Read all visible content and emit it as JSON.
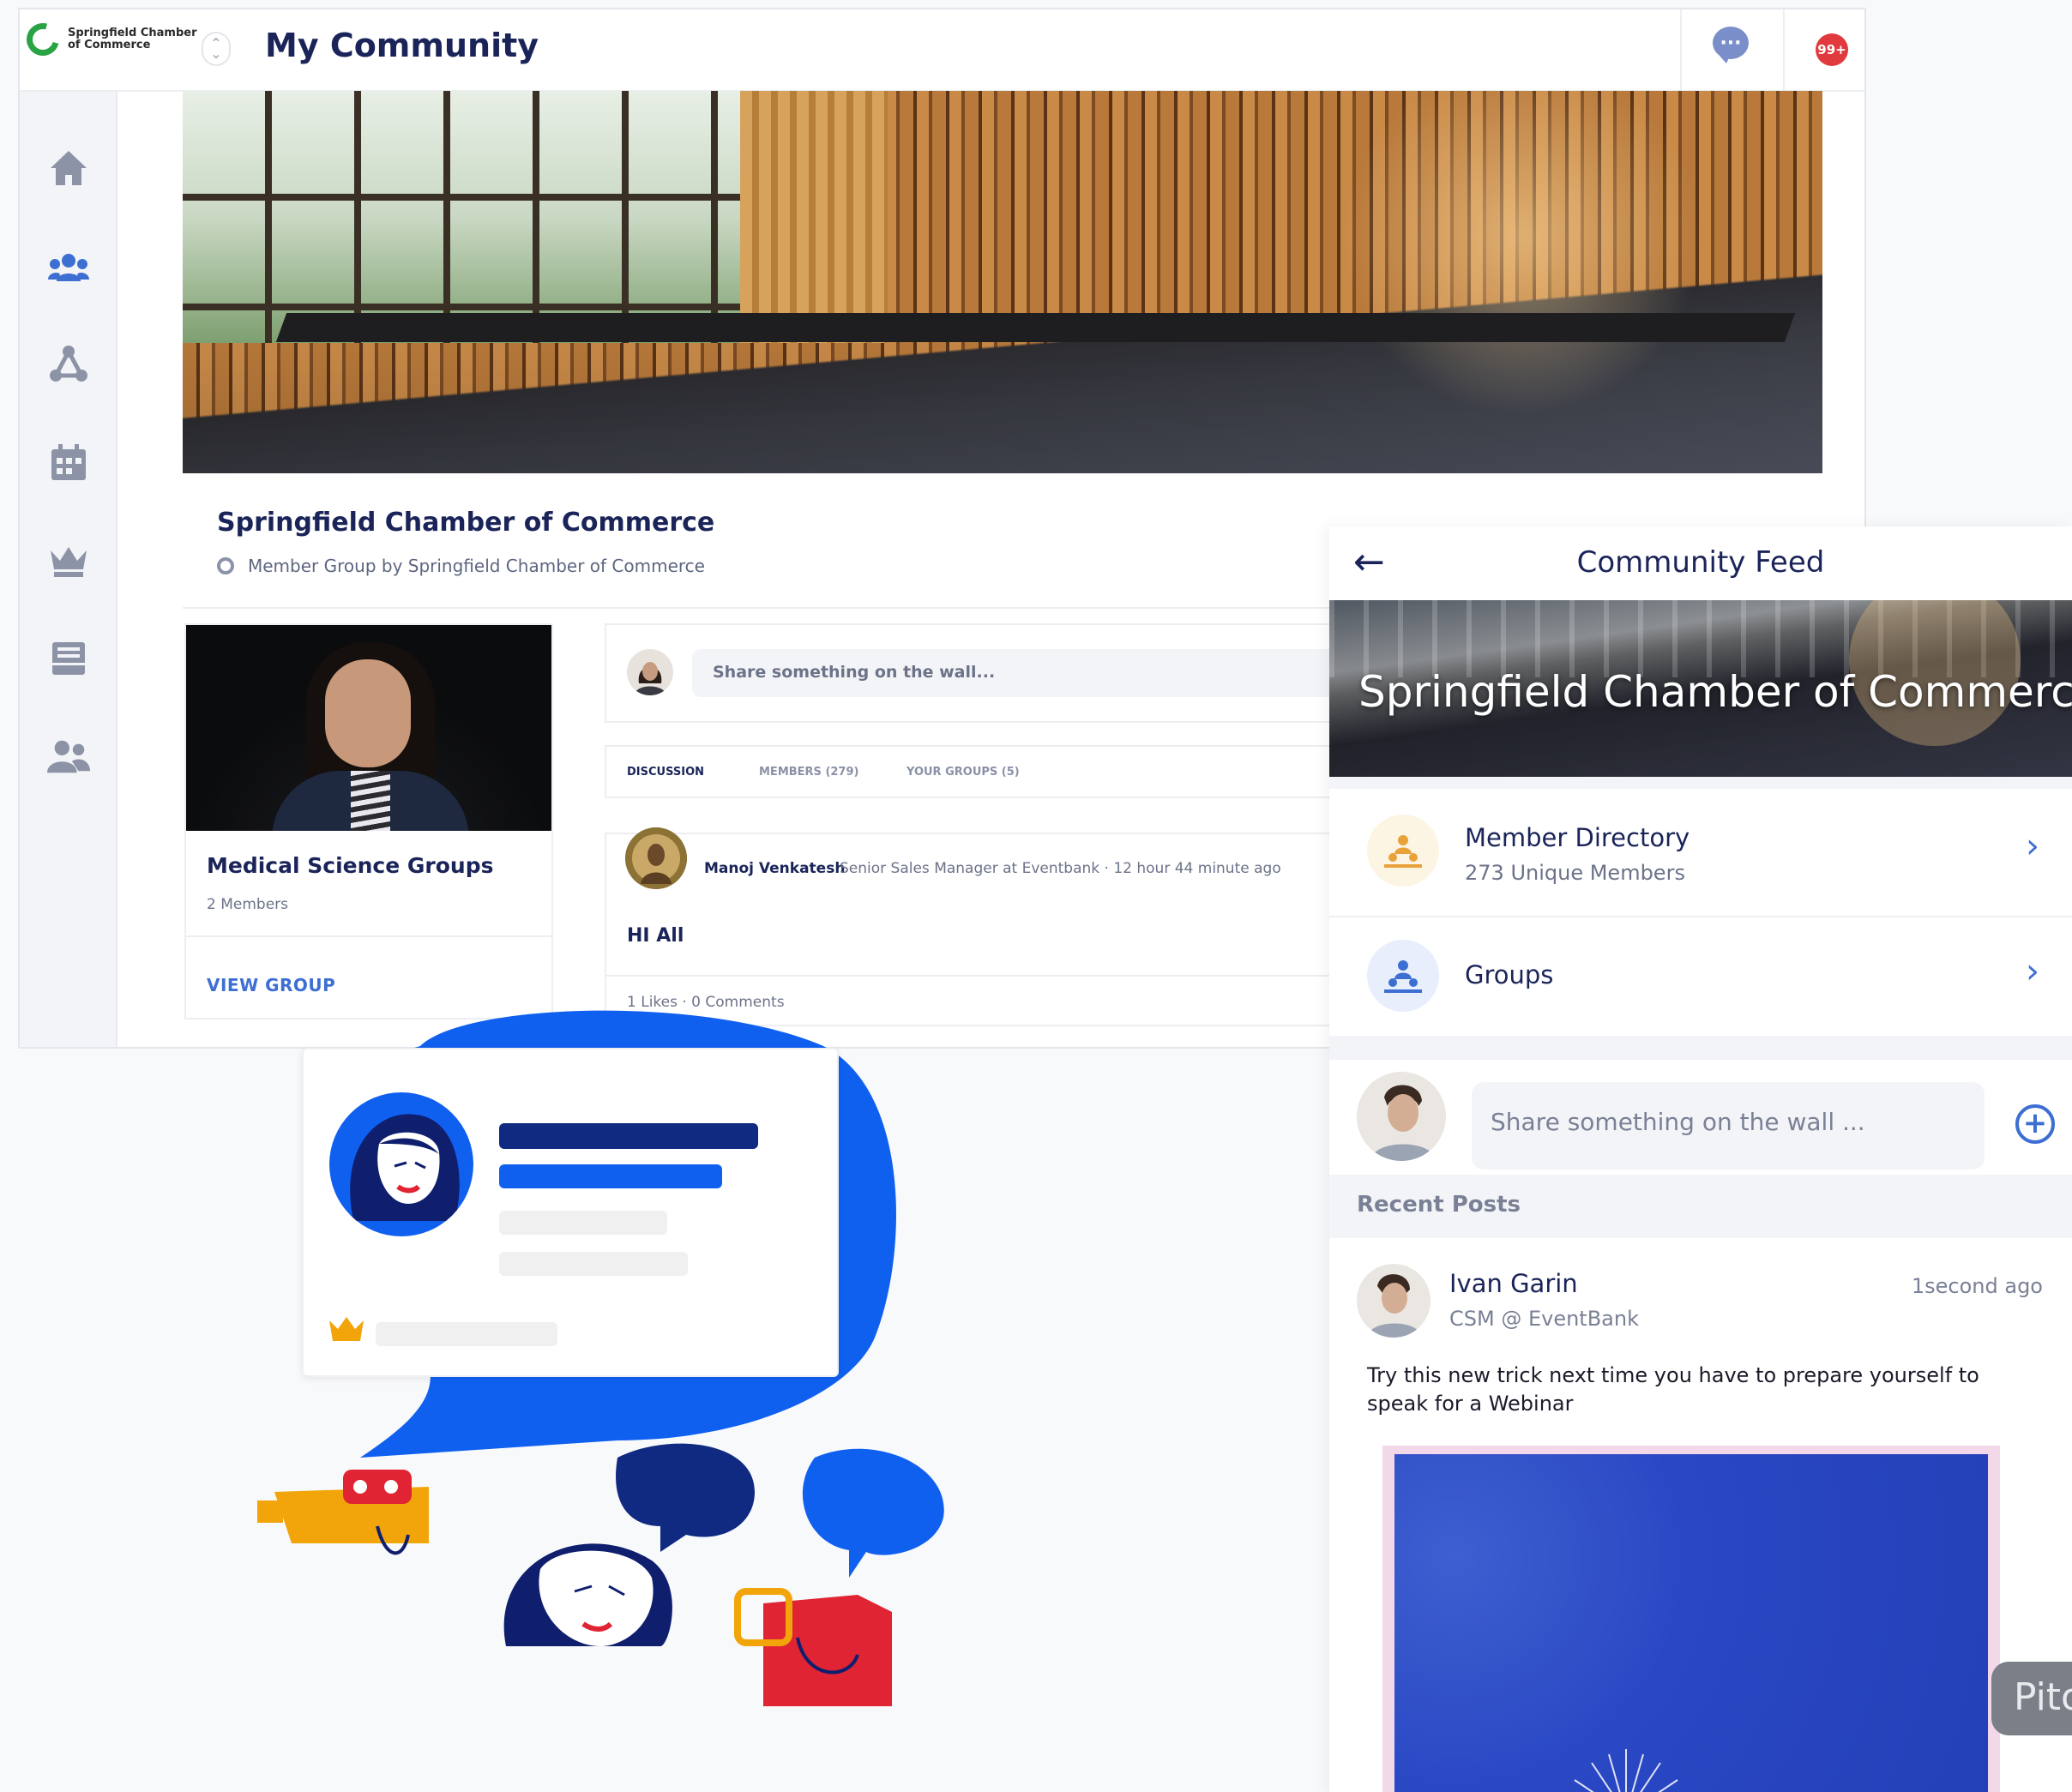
{
  "desktop": {
    "logo_text": "Springfield Chamber of Commerce",
    "app_title": "My Community",
    "notification_badge": "99+",
    "sidebar_icons": [
      "home-icon",
      "community-icon",
      "network-icon",
      "calendar-icon",
      "crown-icon",
      "inbox-icon",
      "members-icon"
    ],
    "group": {
      "name": "Springfield Chamber of Commerce",
      "subtitle": "Member Group by Springfield Chamber of Commerce"
    },
    "group_card": {
      "title": "Medical Science Groups",
      "members": "2 Members",
      "link": "VIEW GROUP"
    },
    "share": {
      "placeholder": "Share something on the wall..."
    },
    "tabs": [
      "DISCUSSION",
      "MEMBERS (279)",
      "YOUR GROUPS (5)"
    ],
    "post": {
      "author": "Manoj Venkatesh",
      "meta": "Senior Sales Manager at Eventbank · 12 hour 44 minute ago",
      "body": "HI All",
      "stats": "1 Likes  · 0 Comments"
    }
  },
  "mobile": {
    "title": "Community Feed",
    "banner_text": "Springfield Chamber of Commerce",
    "member_directory": {
      "title": "Member Directory",
      "subtitle": "273 Unique Members"
    },
    "groups": {
      "title": "Groups"
    },
    "share_placeholder": "Share something on the wall ...",
    "recent_posts_label": "Recent Posts",
    "post": {
      "author": "Ivan Garin",
      "role": "CSM @ EventBank",
      "time": "1second ago",
      "body": "Try this new trick next time you have to prepare yourself to speak for a Webinar"
    }
  },
  "watermark": "Pito",
  "colors": {
    "brand_navy": "#1a2459",
    "accent_blue": "#1060f0",
    "link_blue": "#3d6fd2",
    "badge_red": "#e0393e",
    "logo_green": "#29a343"
  }
}
